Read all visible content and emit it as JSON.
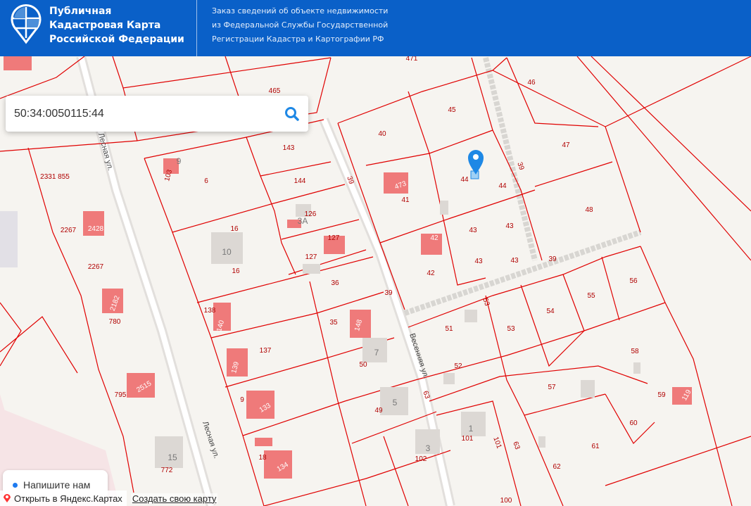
{
  "header": {
    "title_lines": [
      "Публичная",
      "Кадастровая Карта",
      "Российской Федерации"
    ],
    "subtitle_lines": [
      "Заказ сведений об объекте недвижимости",
      "из Федеральной Службы Государственной",
      "Регистрации Кадастра и Картографии РФ"
    ]
  },
  "search": {
    "value": "50:34:0050115:44"
  },
  "chat": {
    "label": "Напишите нам"
  },
  "footer": {
    "open_yandex": "Открыть в Яндекс.Картах",
    "create_map": "Создать свою карту"
  },
  "colors": {
    "header": "#0a60c8",
    "parcel_line": "#e00000",
    "building": "#ef7a7a",
    "pin": "#1e88e5"
  },
  "map": {
    "labels": [
      "471",
      "465",
      "46",
      "45",
      "40",
      "143",
      "47",
      "6",
      "144",
      "39",
      "39",
      "473",
      "44",
      "44",
      "41",
      "48",
      "2331 855",
      "16",
      "126",
      "127",
      "42",
      "43",
      "43",
      "2267",
      "2428",
      "10",
      "127",
      "16",
      "42",
      "43",
      "43",
      "39",
      "2267",
      "36",
      "39",
      "56",
      "55",
      "54",
      "53",
      "2182",
      "138",
      "140",
      "35",
      "148",
      "51",
      "53",
      "780",
      "137",
      "7",
      "50",
      "Весенняя ул.",
      "52",
      "58",
      "139",
      "795",
      "2515",
      "9",
      "133",
      "49",
      "5",
      "63",
      "57",
      "59",
      "119",
      "60",
      "Лесная ул.",
      "1",
      "101",
      "101",
      "3",
      "102",
      "63",
      "61",
      "62",
      "15",
      "772",
      "18",
      "134",
      "100",
      "Лесная ул.",
      "3А",
      "9",
      "103"
    ]
  }
}
